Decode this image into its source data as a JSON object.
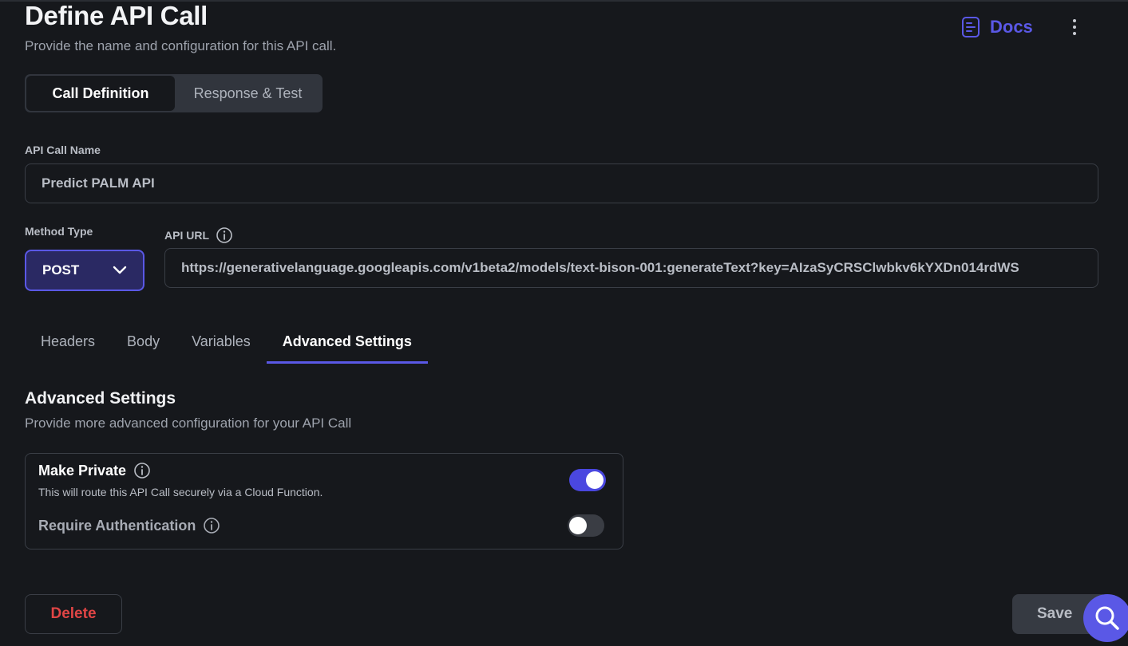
{
  "header": {
    "title": "Define API Call",
    "subtitle": "Provide the name and configuration for this API call.",
    "docs_label": "Docs"
  },
  "segments": [
    {
      "label": "Call Definition",
      "active": true
    },
    {
      "label": "Response & Test",
      "active": false
    }
  ],
  "form": {
    "name_label": "API Call Name",
    "name_value": "Predict PALM API",
    "method_label": "Method Type",
    "method_value": "POST",
    "url_label": "API URL",
    "url_value": "https://generativelanguage.googleapis.com/v1beta2/models/text-bison-001:generateText?key=AIzaSyCRSClwbkv6kYXDn014rdWS"
  },
  "tabs": [
    {
      "label": "Headers",
      "active": false
    },
    {
      "label": "Body",
      "active": false
    },
    {
      "label": "Variables",
      "active": false
    },
    {
      "label": "Advanced Settings",
      "active": true
    }
  ],
  "advanced": {
    "title": "Advanced Settings",
    "subtitle": "Provide more advanced configuration for your API Call",
    "make_private": {
      "label": "Make Private",
      "description": "This will route this API Call securely via a Cloud Function.",
      "enabled": true
    },
    "require_auth": {
      "label": "Require Authentication",
      "enabled": false
    }
  },
  "footer": {
    "delete_label": "Delete",
    "save_label": "Save"
  },
  "colors": {
    "accent": "#5a58e6",
    "danger": "#e04545",
    "background": "#16181c"
  }
}
